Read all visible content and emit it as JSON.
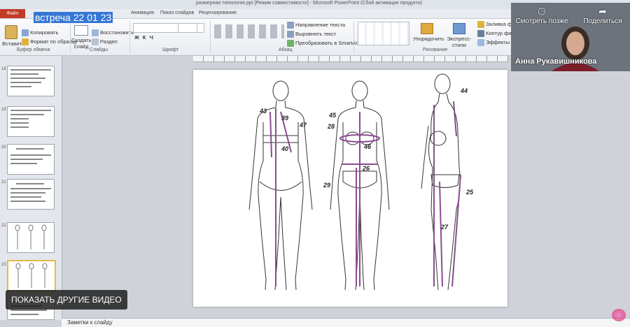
{
  "window": {
    "title": "размерная типология.ppt [Режим совместимости] - Microsoft PowerPoint (Сбой активации продукта)"
  },
  "tabs": {
    "file": "Файл",
    "items": [
      "Анимация",
      "Показ слайдов",
      "Рецензирование"
    ]
  },
  "ribbon": {
    "clipboard": {
      "paste": "Вставить",
      "copy": "Копировать",
      "format": "Формат по образцу",
      "label": "Буфер обмена"
    },
    "slides": {
      "new": "Создать слайд",
      "restore": "Восстановить",
      "delete": "Раздел",
      "label": "Слайды"
    },
    "font": {
      "label": "Шрифт"
    },
    "paragraph": {
      "direction": "Направление текста",
      "align": "Выровнять текст",
      "smartart": "Преобразовать в SmartArt",
      "label": "Абзац"
    },
    "drawing": {
      "arrange": "Упорядочить",
      "quickstyles": "Экспресс-стили",
      "fill": "Заливка фигуры",
      "outline": "Контур фигуры",
      "effects": "Эффекты фигур",
      "label": "Рисование"
    }
  },
  "slides_panel": {
    "numbers": [
      "18",
      "19",
      "20",
      "21",
      "22",
      "23"
    ]
  },
  "slide": {
    "labels": {
      "m43": "43",
      "m39": "39",
      "m47": "47",
      "m40": "40",
      "m45": "45",
      "m28": "28",
      "m46": "46",
      "m26": "26",
      "m29": "29",
      "m44": "44",
      "m25": "25",
      "m27": "27"
    }
  },
  "notes": {
    "placeholder": "Заметки к слайду"
  },
  "video": {
    "title": "встреча 22 01 23",
    "more": "ПОКАЗАТЬ ДРУГИЕ ВИДЕО",
    "watch_later": "Смотреть позже",
    "share": "Поделиться",
    "presenter": "Анна Рукавишникова"
  }
}
